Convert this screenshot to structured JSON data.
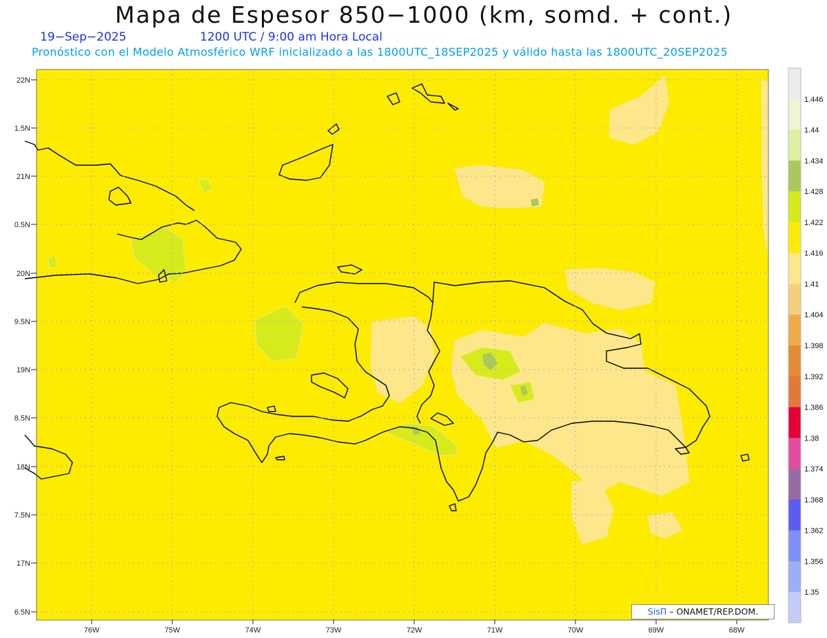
{
  "header": {
    "title": "Mapa de Espesor 850−1000 (km, somd. + cont.)",
    "date": "19−Sep−2025",
    "time": "1200 UTC / 9:00 am Hora Local",
    "forecast": "Pronóstico con el Modelo Atmosférico WRF inicializado a las 1800UTC_18SEP2025 y válido hasta las  1800UTC_20SEP2025"
  },
  "map": {
    "lat_labels": [
      "22N",
      "1.5N",
      "21N",
      "0.5N",
      "20N",
      "9.5N",
      "19N",
      "8.5N",
      "18N",
      "7.5N",
      "17N",
      "6.5N"
    ],
    "lon_labels": [
      "76W",
      "75W",
      "74W",
      "73W",
      "72W",
      "71W",
      "70W",
      "69W",
      "68W"
    ],
    "background_value": 1.416
  },
  "legend": {
    "levels": [
      "1.446",
      "1.44",
      "1.434",
      "1.428",
      "1.422",
      "1.416",
      "1.41",
      "1.404",
      "1.398",
      "1.392",
      "1.386",
      "1.38",
      "1.374",
      "1.368",
      "1.362",
      "1.356",
      "1.35"
    ],
    "colors": [
      "#ececec",
      "#eef5d2",
      "#dff0a0",
      "#a9c95e",
      "#d7ea1b",
      "#fdec00",
      "#fde78a",
      "#f5cf7c",
      "#efab4a",
      "#e48c35",
      "#e07a38",
      "#e6003a",
      "#e44ca0",
      "#9a6aa6",
      "#5c5cf5",
      "#7e90f5",
      "#9aaff5",
      "#c3ccf7"
    ]
  },
  "credit": {
    "logo": "SisΠ",
    "text": "– ONAMET/REP.DOM."
  }
}
